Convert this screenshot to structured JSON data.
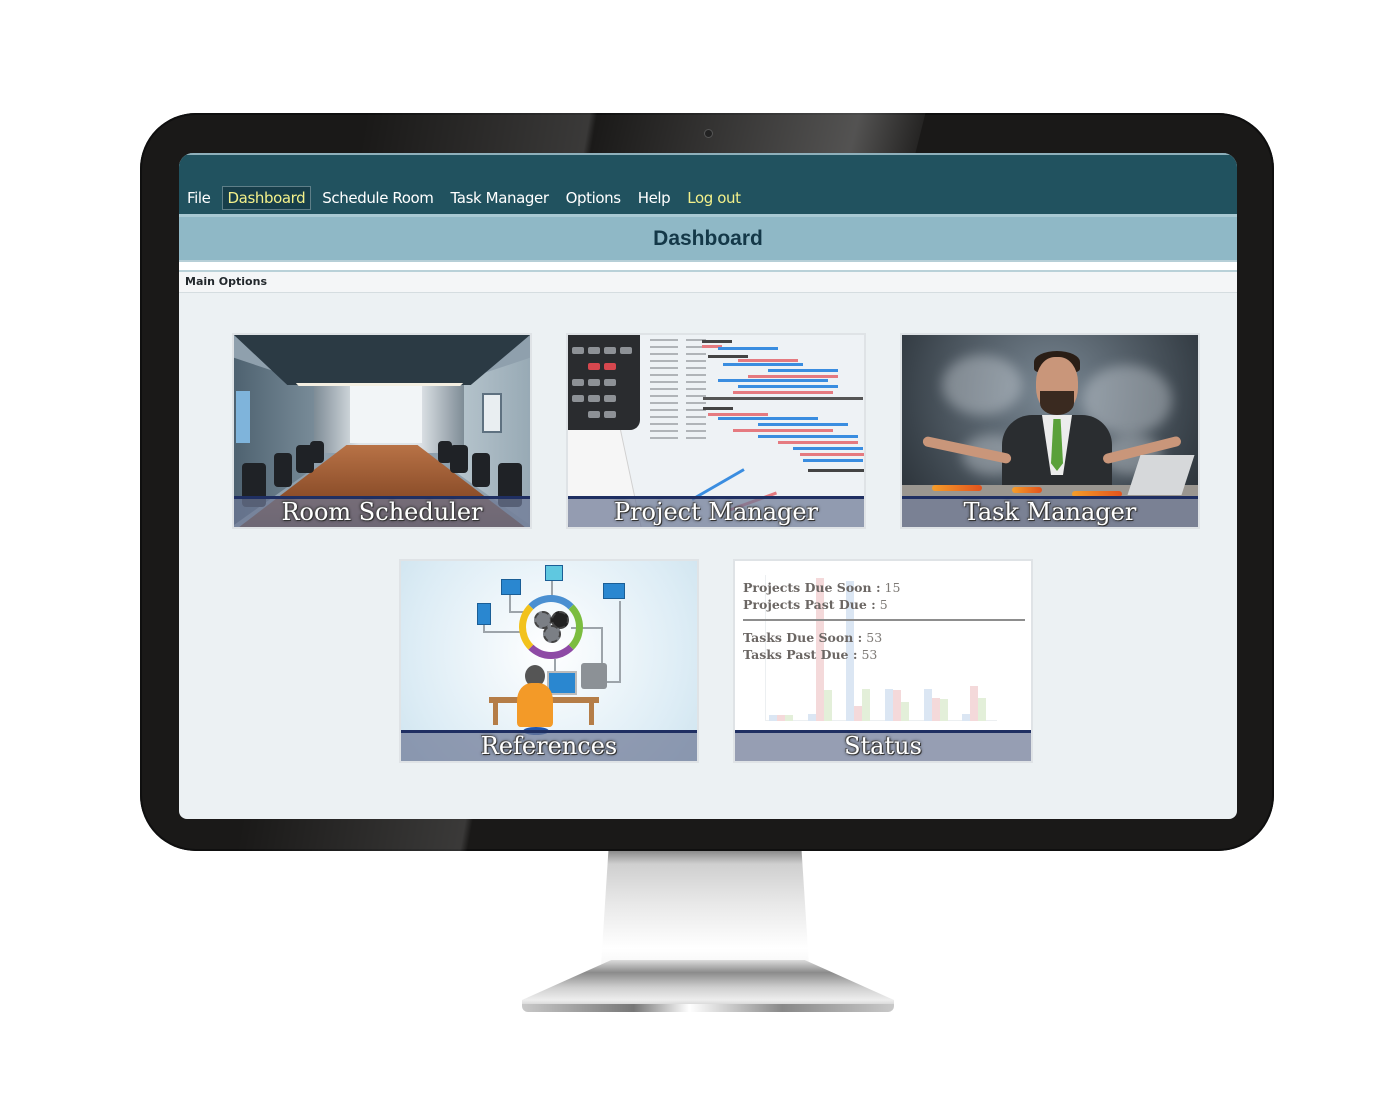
{
  "menu": {
    "items": [
      {
        "label": "File",
        "active": false
      },
      {
        "label": "Dashboard",
        "active": true
      },
      {
        "label": "Schedule Room",
        "active": false
      },
      {
        "label": "Task Manager",
        "active": false
      },
      {
        "label": "Options",
        "active": false
      },
      {
        "label": "Help",
        "active": false
      },
      {
        "label": "Log out",
        "active": false
      }
    ]
  },
  "header": {
    "title": "Dashboard"
  },
  "section": {
    "label": "Main Options"
  },
  "tiles": [
    {
      "caption": "Room Scheduler",
      "image": "conference-room"
    },
    {
      "caption": "Project Manager",
      "image": "gantt-chart-calculator"
    },
    {
      "caption": "Task Manager",
      "image": "overwhelmed-businessman"
    },
    {
      "caption": "References",
      "image": "network-workstation"
    },
    {
      "caption": "Status",
      "image": "status-summary"
    }
  ],
  "status": {
    "projects_due_soon_label": "Projects Due Soon :",
    "projects_due_soon_value": "15",
    "projects_past_due_label": "Projects Past Due :",
    "projects_past_due_value": "5",
    "tasks_due_soon_label": "Tasks Due Soon :",
    "tasks_due_soon_value": "53",
    "tasks_past_due_label": "Tasks Past Due :",
    "tasks_past_due_value": "53"
  },
  "colors": {
    "navbar": "#21525f",
    "menu_active_text": "#f3f08a",
    "title_bar": "#8fb8c6",
    "title_text": "#143848",
    "screen_bg": "#ecf1f3",
    "caption_rule": "#1f2f62",
    "series_blue": "#dbe6f3",
    "series_red": "#f4d9da",
    "series_green": "#e3efd9"
  },
  "status_background_chart": {
    "groups": 6,
    "series": [
      {
        "name": "blue",
        "values": [
          4,
          5,
          96,
          22,
          22,
          5
        ]
      },
      {
        "name": "red",
        "values": [
          4,
          98,
          10,
          21,
          16,
          24
        ]
      },
      {
        "name": "green",
        "values": [
          4,
          21,
          22,
          13,
          15,
          16
        ]
      }
    ]
  }
}
